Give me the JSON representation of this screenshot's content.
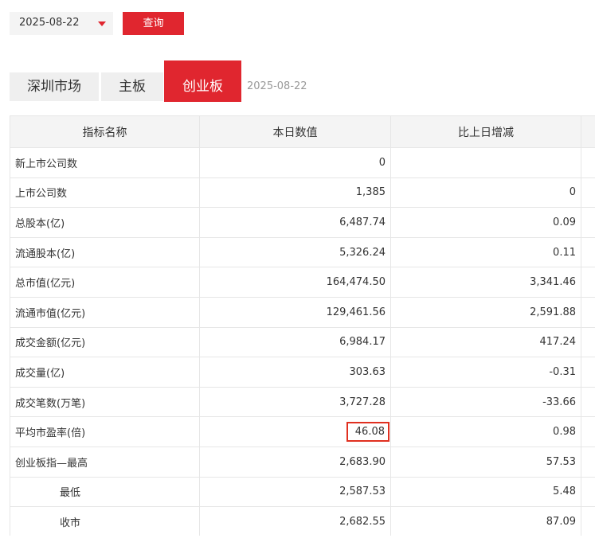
{
  "toolbar": {
    "date_value": "2025-08-22",
    "query_label": "查询"
  },
  "tabs": [
    {
      "label": "深圳市场"
    },
    {
      "label": "主板"
    },
    {
      "label": "创业板"
    }
  ],
  "tab_date": "2025-08-22",
  "table": {
    "headers": [
      "指标名称",
      "本日数值",
      "比上日增减",
      ""
    ],
    "rows": [
      {
        "name": "新上市公司数",
        "today": "0",
        "change": ""
      },
      {
        "name": "上市公司数",
        "today": "1,385",
        "change": "0"
      },
      {
        "name": "总股本(亿)",
        "today": "6,487.74",
        "change": "0.09"
      },
      {
        "name": "流通股本(亿)",
        "today": "5,326.24",
        "change": "0.11"
      },
      {
        "name": "总市值(亿元)",
        "today": "164,474.50",
        "change": "3,341.46"
      },
      {
        "name": "流通市值(亿元)",
        "today": "129,461.56",
        "change": "2,591.88"
      },
      {
        "name": "成交金额(亿元)",
        "today": "6,984.17",
        "change": "417.24"
      },
      {
        "name": "成交量(亿)",
        "today": "303.63",
        "change": "-0.31"
      },
      {
        "name": "成交笔数(万笔)",
        "today": "3,727.28",
        "change": "-33.66"
      },
      {
        "name": "平均市盈率(倍)",
        "today": "46.08",
        "change": "0.98"
      },
      {
        "name": "创业板指—最高",
        "today": "2,683.90",
        "change": "57.53"
      },
      {
        "name": "最低",
        "today": "2,587.53",
        "change": "5.48"
      },
      {
        "name": "收市",
        "today": "2,682.55",
        "change": "87.09"
      }
    ]
  },
  "colors": {
    "accent": "#e0262f",
    "highlight_box": "#e03020"
  }
}
